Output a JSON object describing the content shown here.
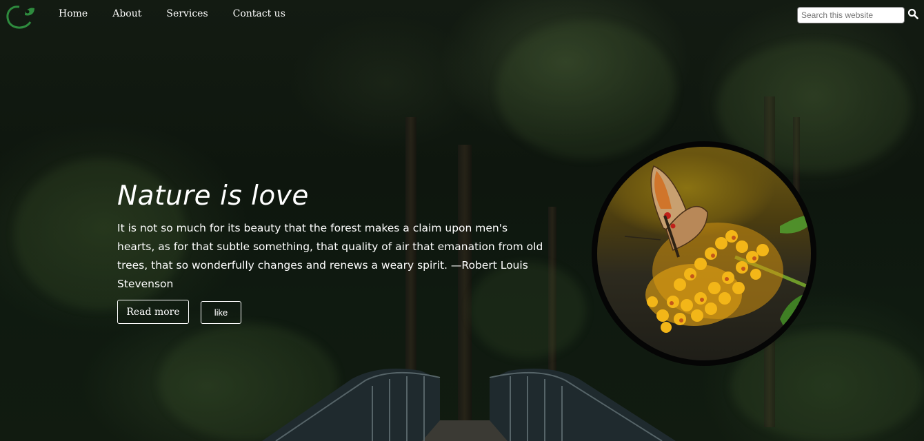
{
  "nav": {
    "links": [
      {
        "label": "Home"
      },
      {
        "label": "About"
      },
      {
        "label": "Services"
      },
      {
        "label": "Contact us"
      }
    ],
    "search": {
      "placeholder": "Search this website"
    }
  },
  "hero": {
    "title": "Nature is love",
    "quote": "It is not so much for its beauty that the forest makes a claim upon men's hearts, as for that subtle something, that quality of air that emanation from old trees, that so wonderfully changes and renews a weary spirit. —Robert Louis Stevenson",
    "buttons": {
      "read_more": "Read more",
      "like": "like"
    }
  },
  "colors": {
    "accent": "#2e8b3e",
    "text": "#ffffff",
    "background": "#0e160e"
  },
  "icons": {
    "logo": "leaf-swirl-logo",
    "search": "search-icon"
  }
}
